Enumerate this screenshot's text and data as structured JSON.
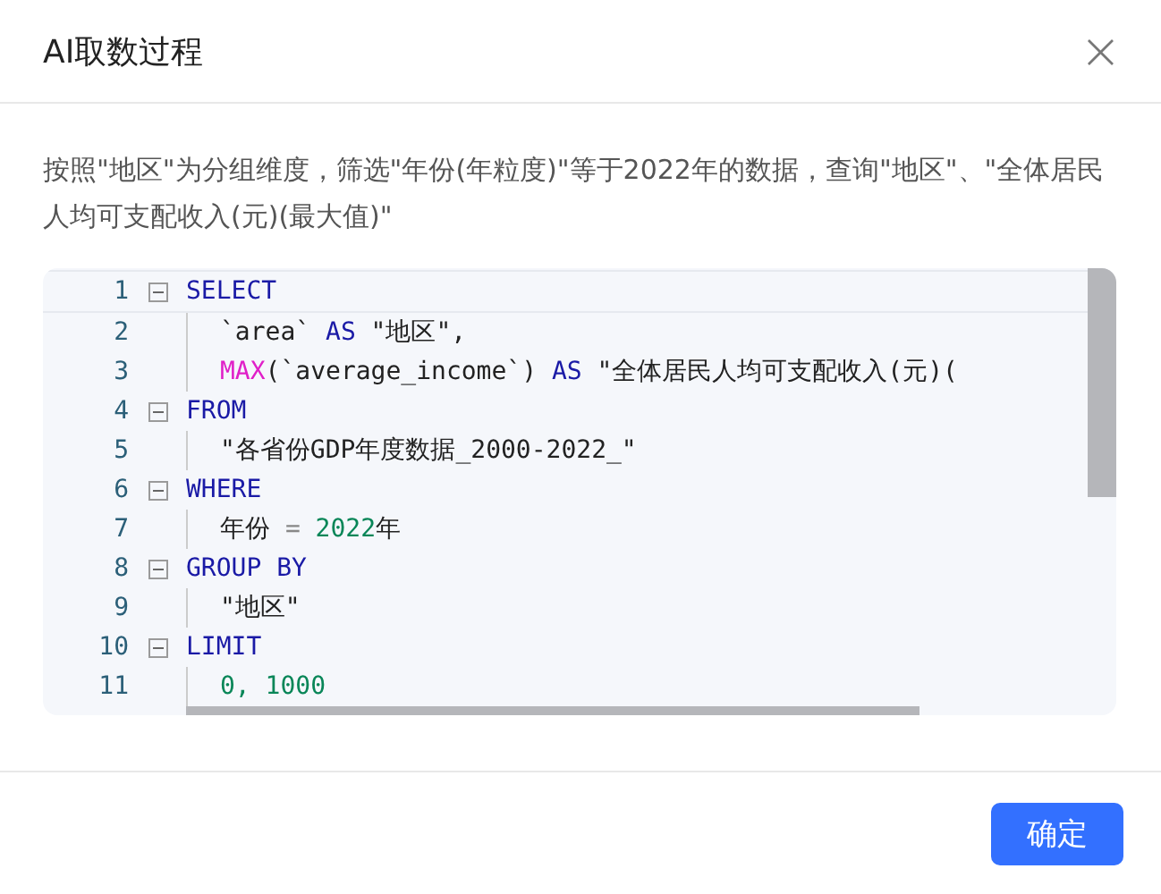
{
  "dialog": {
    "title": "AI取数过程",
    "close": "×",
    "description": "按照\"地区\"为分组维度，筛选\"年份(年粒度)\"等于2022年的数据，查询\"地区\"、\"全体居民人均可支配收入(元)(最大值)\""
  },
  "editor": {
    "lines": [
      {
        "number": "1",
        "expanded": true,
        "current": true,
        "tokens": [
          {
            "kind": "kw",
            "text": "SELECT"
          }
        ],
        "children": [
          {
            "number": "2",
            "tokens": [
              {
                "kind": "text",
                "text": "`area` "
              },
              {
                "kind": "kw",
                "text": "AS"
              },
              {
                "kind": "text",
                "text": " \"地区\","
              }
            ]
          },
          {
            "number": "3",
            "tokens": [
              {
                "kind": "fn",
                "text": "MAX"
              },
              {
                "kind": "text",
                "text": "(`average_income`) "
              },
              {
                "kind": "kw",
                "text": "AS"
              },
              {
                "kind": "text",
                "text": " \"全体居民人均可支配收入(元)("
              }
            ]
          }
        ]
      },
      {
        "number": "4",
        "expanded": true,
        "current": false,
        "tokens": [
          {
            "kind": "kw",
            "text": "FROM"
          }
        ],
        "children": [
          {
            "number": "5",
            "tokens": [
              {
                "kind": "text",
                "text": "\"各省份GDP年度数据_2000-2022_\""
              }
            ]
          }
        ]
      },
      {
        "number": "6",
        "expanded": true,
        "current": false,
        "tokens": [
          {
            "kind": "kw",
            "text": "WHERE"
          }
        ],
        "children": [
          {
            "number": "7",
            "tokens": [
              {
                "kind": "text",
                "text": "年份 "
              },
              {
                "kind": "op",
                "text": "="
              },
              {
                "kind": "num",
                "text": " 2022"
              },
              {
                "kind": "text",
                "text": "年"
              }
            ]
          }
        ]
      },
      {
        "number": "8",
        "expanded": true,
        "current": false,
        "tokens": [
          {
            "kind": "kw",
            "text": "GROUP BY"
          }
        ],
        "children": [
          {
            "number": "9",
            "tokens": [
              {
                "kind": "text",
                "text": "\"地区\""
              }
            ]
          }
        ]
      },
      {
        "number": "10",
        "expanded": true,
        "current": false,
        "tokens": [
          {
            "kind": "kw",
            "text": "LIMIT"
          }
        ],
        "children": [
          {
            "number": "11",
            "tokens": [
              {
                "kind": "num",
                "text": "0, 1000"
              }
            ]
          }
        ]
      }
    ]
  },
  "footer": {
    "buttons": [
      "确定"
    ]
  }
}
